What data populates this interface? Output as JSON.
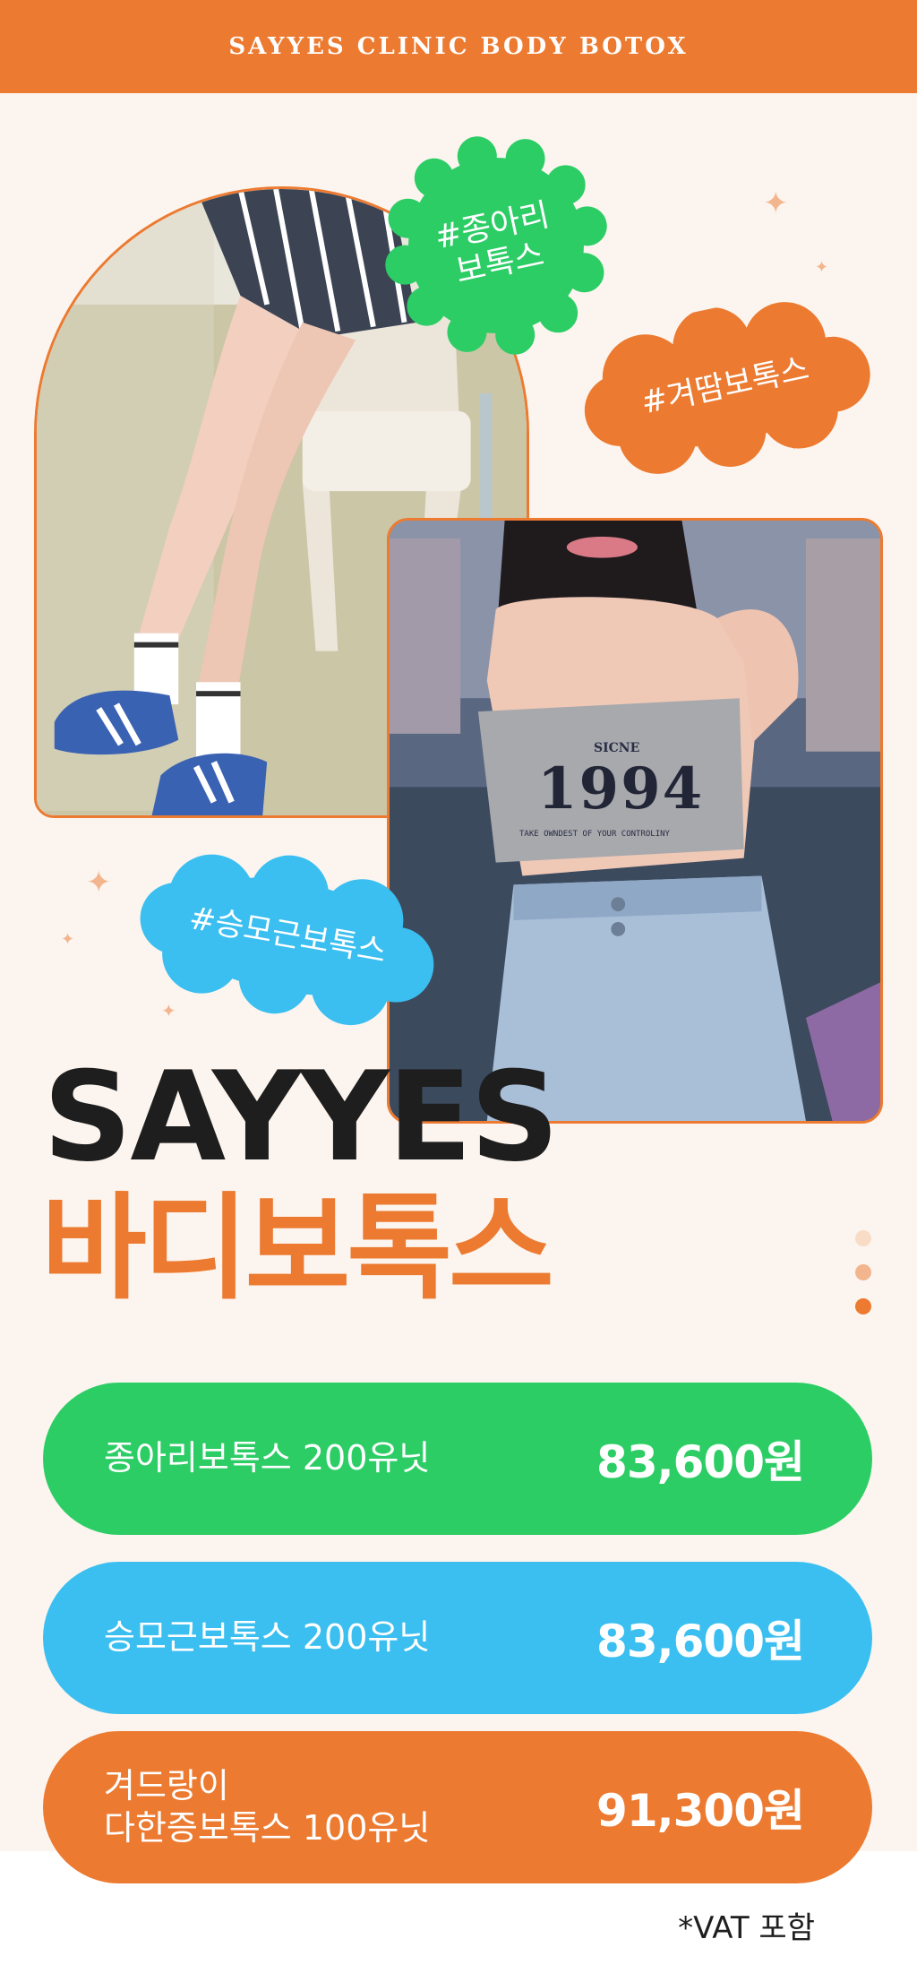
{
  "header": {
    "title": "SAYYES CLINIC BODY BOTOX"
  },
  "badges": {
    "calf": "#종아리\n보톡스",
    "armpit": "#겨땀보톡스",
    "trapezius": "#승모근보톡스"
  },
  "photos": {
    "top_print_small": "SICNE",
    "top_print_big": "1994",
    "top_print_line": "TAKE OWNDEST OF YOUR CONTROLINY"
  },
  "title": {
    "en": "SAYYES",
    "ko": "바디보톡스"
  },
  "prices": [
    {
      "name": "종아리보톡스 200유닛",
      "price": "83,600원",
      "color": "#2dcd66"
    },
    {
      "name": "승모근보톡스 200유닛",
      "price": "83,600원",
      "color": "#3bbff0"
    },
    {
      "name": "겨드랑이\n다한증보톡스 100유닛",
      "price": "91,300원",
      "color": "#ec7a30"
    }
  ],
  "note": "*VAT 포함",
  "colors": {
    "accent": "#ec7a30",
    "green": "#2dcd66",
    "blue": "#3bbff0",
    "background": "#fcf5ef"
  }
}
